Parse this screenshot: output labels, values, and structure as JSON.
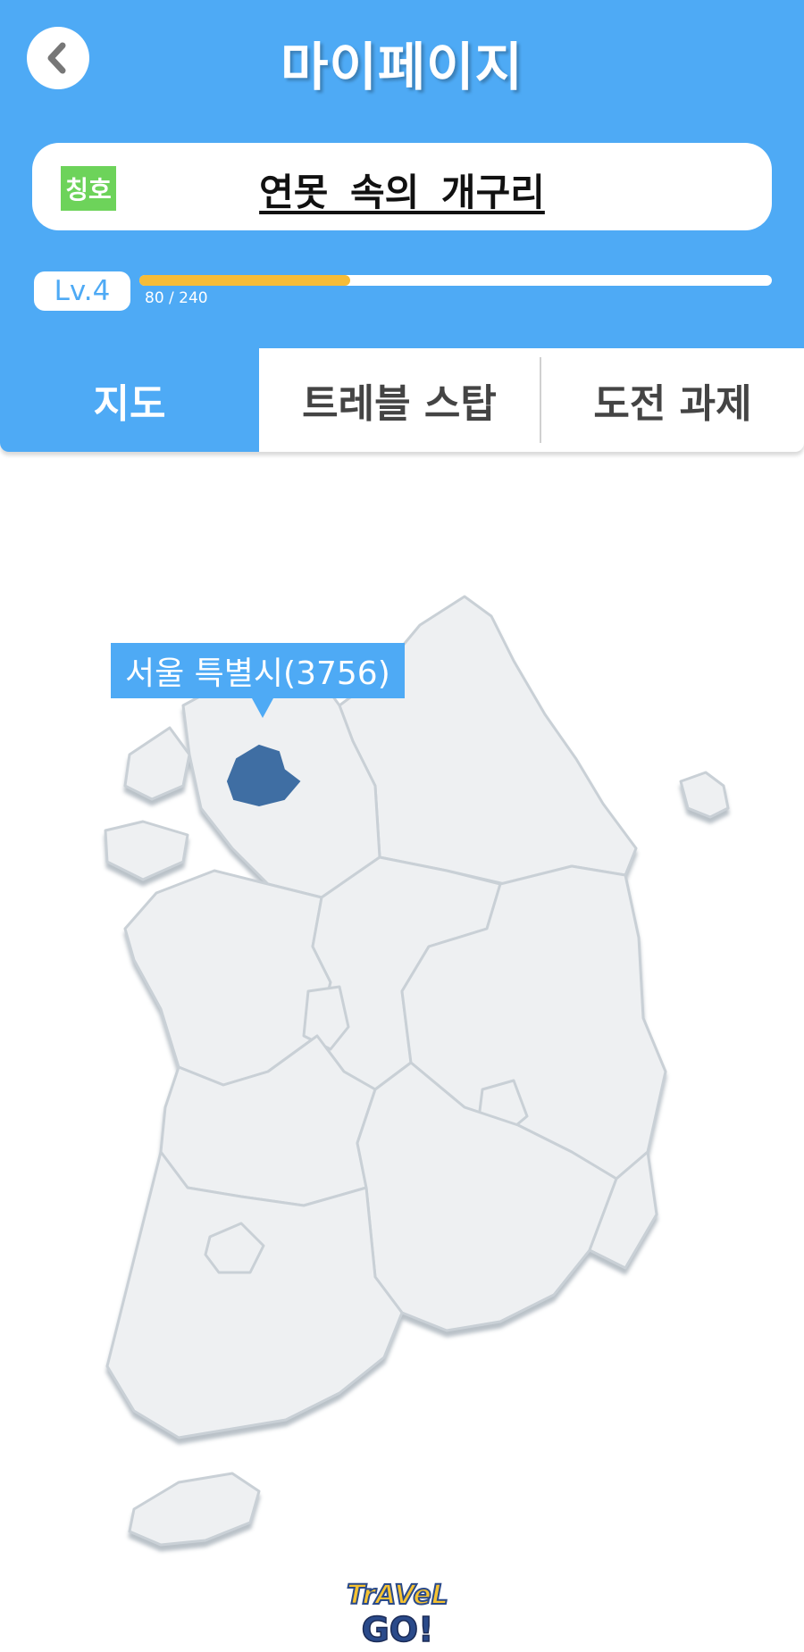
{
  "header": {
    "title": "마이페이지",
    "back_icon": "chevron-left-icon"
  },
  "profile": {
    "title_badge": "칭호",
    "title_name": "연못 속의 개구리",
    "level": "Lv.4",
    "xp_text": "80 / 240",
    "xp_progress": 0.333
  },
  "tabs": [
    {
      "label": "지도",
      "active": true
    },
    {
      "label": "트레블 스탑",
      "active": false
    },
    {
      "label": "도전 과제",
      "active": false
    }
  ],
  "map": {
    "selected_region_label": "서울 특별시(3756)",
    "selected_color": "#3f6ea3",
    "region_color": "#eef0f2",
    "border_color": "#c9d0d6"
  },
  "logo": {
    "line1": "TrAVeL",
    "line2": "GO!"
  },
  "colors": {
    "primary": "#4eaaf5",
    "badge": "#6dd35a",
    "progress": "#f6bc38"
  }
}
